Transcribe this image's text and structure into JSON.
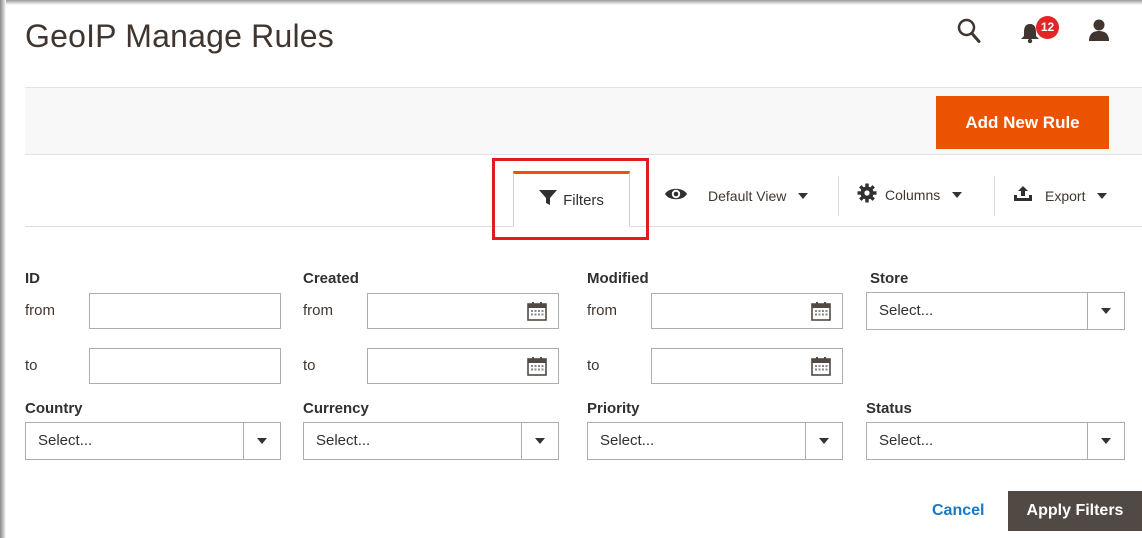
{
  "header": {
    "title": "GeoIP Manage Rules",
    "notification_count": "12"
  },
  "actions": {
    "add_new_rule": "Add New Rule"
  },
  "toolbar": {
    "filters": "Filters",
    "default_view": "Default View",
    "columns": "Columns",
    "export": "Export"
  },
  "filters": {
    "id_label": "ID",
    "created_label": "Created",
    "modified_label": "Modified",
    "store_label": "Store",
    "from_label": "from",
    "to_label": "to",
    "country_label": "Country",
    "currency_label": "Currency",
    "priority_label": "Priority",
    "status_label": "Status",
    "select_placeholder": "Select..."
  },
  "footer": {
    "cancel": "Cancel",
    "apply": "Apply Filters"
  },
  "colors": {
    "accent": "#eb5202",
    "highlight": "#e01b22",
    "apply_bg": "#514943",
    "link": "#1979c3",
    "badge": "#e22626"
  }
}
